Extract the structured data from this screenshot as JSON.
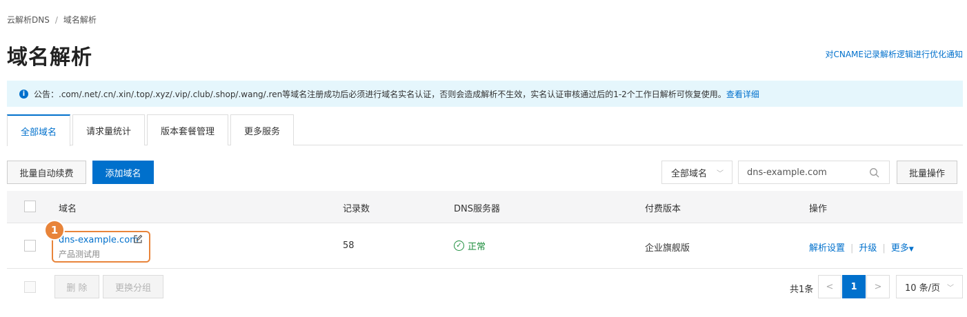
{
  "breadcrumb": {
    "root": "云解析DNS",
    "separator": "/",
    "current": "域名解析"
  },
  "page": {
    "title": "域名解析",
    "top_link": "对CNAME记录解析逻辑进行优化通知"
  },
  "notice": {
    "icon": "info-icon",
    "text": "公告：.com/.net/.cn/.xin/.top/.xyz/.vip/.club/.shop/.wang/.ren等域名注册成功后必须进行域名实名认证，否则会造成解析不生效，实名认证审核通过后的1-2个工作日解析可恢复使用。",
    "link": "查看详细"
  },
  "tabs": [
    {
      "label": "全部域名",
      "active": true
    },
    {
      "label": "请求量统计",
      "active": false
    },
    {
      "label": "版本套餐管理",
      "active": false
    },
    {
      "label": "更多服务",
      "active": false
    }
  ],
  "toolbar": {
    "batch_renew": "批量自动续费",
    "add_domain": "添加域名",
    "filter_select": "全部域名",
    "search_value": "dns-example.com",
    "batch_ops": "批量操作"
  },
  "table": {
    "headers": [
      "域名",
      "记录数",
      "DNS服务器",
      "付费版本",
      "操作"
    ],
    "rows": [
      {
        "domain": "dns-example.com",
        "remark": "产品测试用",
        "records": "58",
        "dns_status": "正常",
        "edition": "企业旗舰版",
        "actions": [
          "解析设置",
          "升级",
          "更多"
        ]
      }
    ]
  },
  "annotation": {
    "badge": "1",
    "color": "#e8843a"
  },
  "footer": {
    "delete": "删 除",
    "change_group": "更换分组",
    "total": "共1条",
    "current_page": "1",
    "page_size": "10 条/页"
  },
  "colors": {
    "primary": "#0070cc",
    "notice_bg": "#e5f6fc",
    "success": "#1e8e3e"
  }
}
